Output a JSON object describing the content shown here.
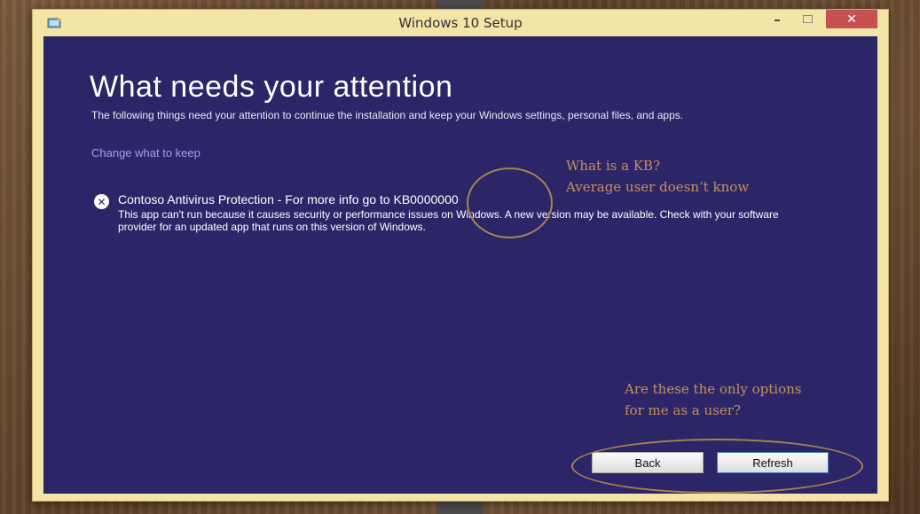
{
  "window": {
    "title": "Windows 10 Setup",
    "controls": {
      "minimize": "–",
      "close": "✕"
    }
  },
  "page": {
    "heading": "What needs your attention",
    "subtitle": "The following things need your attention to continue the installation and keep your Windows settings, personal files, and apps.",
    "change_link": "Change what to keep"
  },
  "issue": {
    "icon": "error-x-icon",
    "title": "Contoso Antivirus Protection - For more info go to KB0000000",
    "description": "This app can't run because it causes security or performance issues on Windows. A new version may be available. Check with your software provider for an updated app that runs on this version of Windows."
  },
  "buttons": {
    "back": "Back",
    "refresh": "Refresh"
  },
  "annotations": {
    "kb_line1": "What is a KB?",
    "kb_line2": "Average user doesn’t know",
    "options_line1": "Are these the only options",
    "options_line2": "for me as a user?"
  },
  "colors": {
    "window_background": "#2c2567",
    "frame": "#f3e4a8",
    "link": "#a79ef0",
    "annotation": "#c6915a",
    "close_button": "#c75050"
  }
}
